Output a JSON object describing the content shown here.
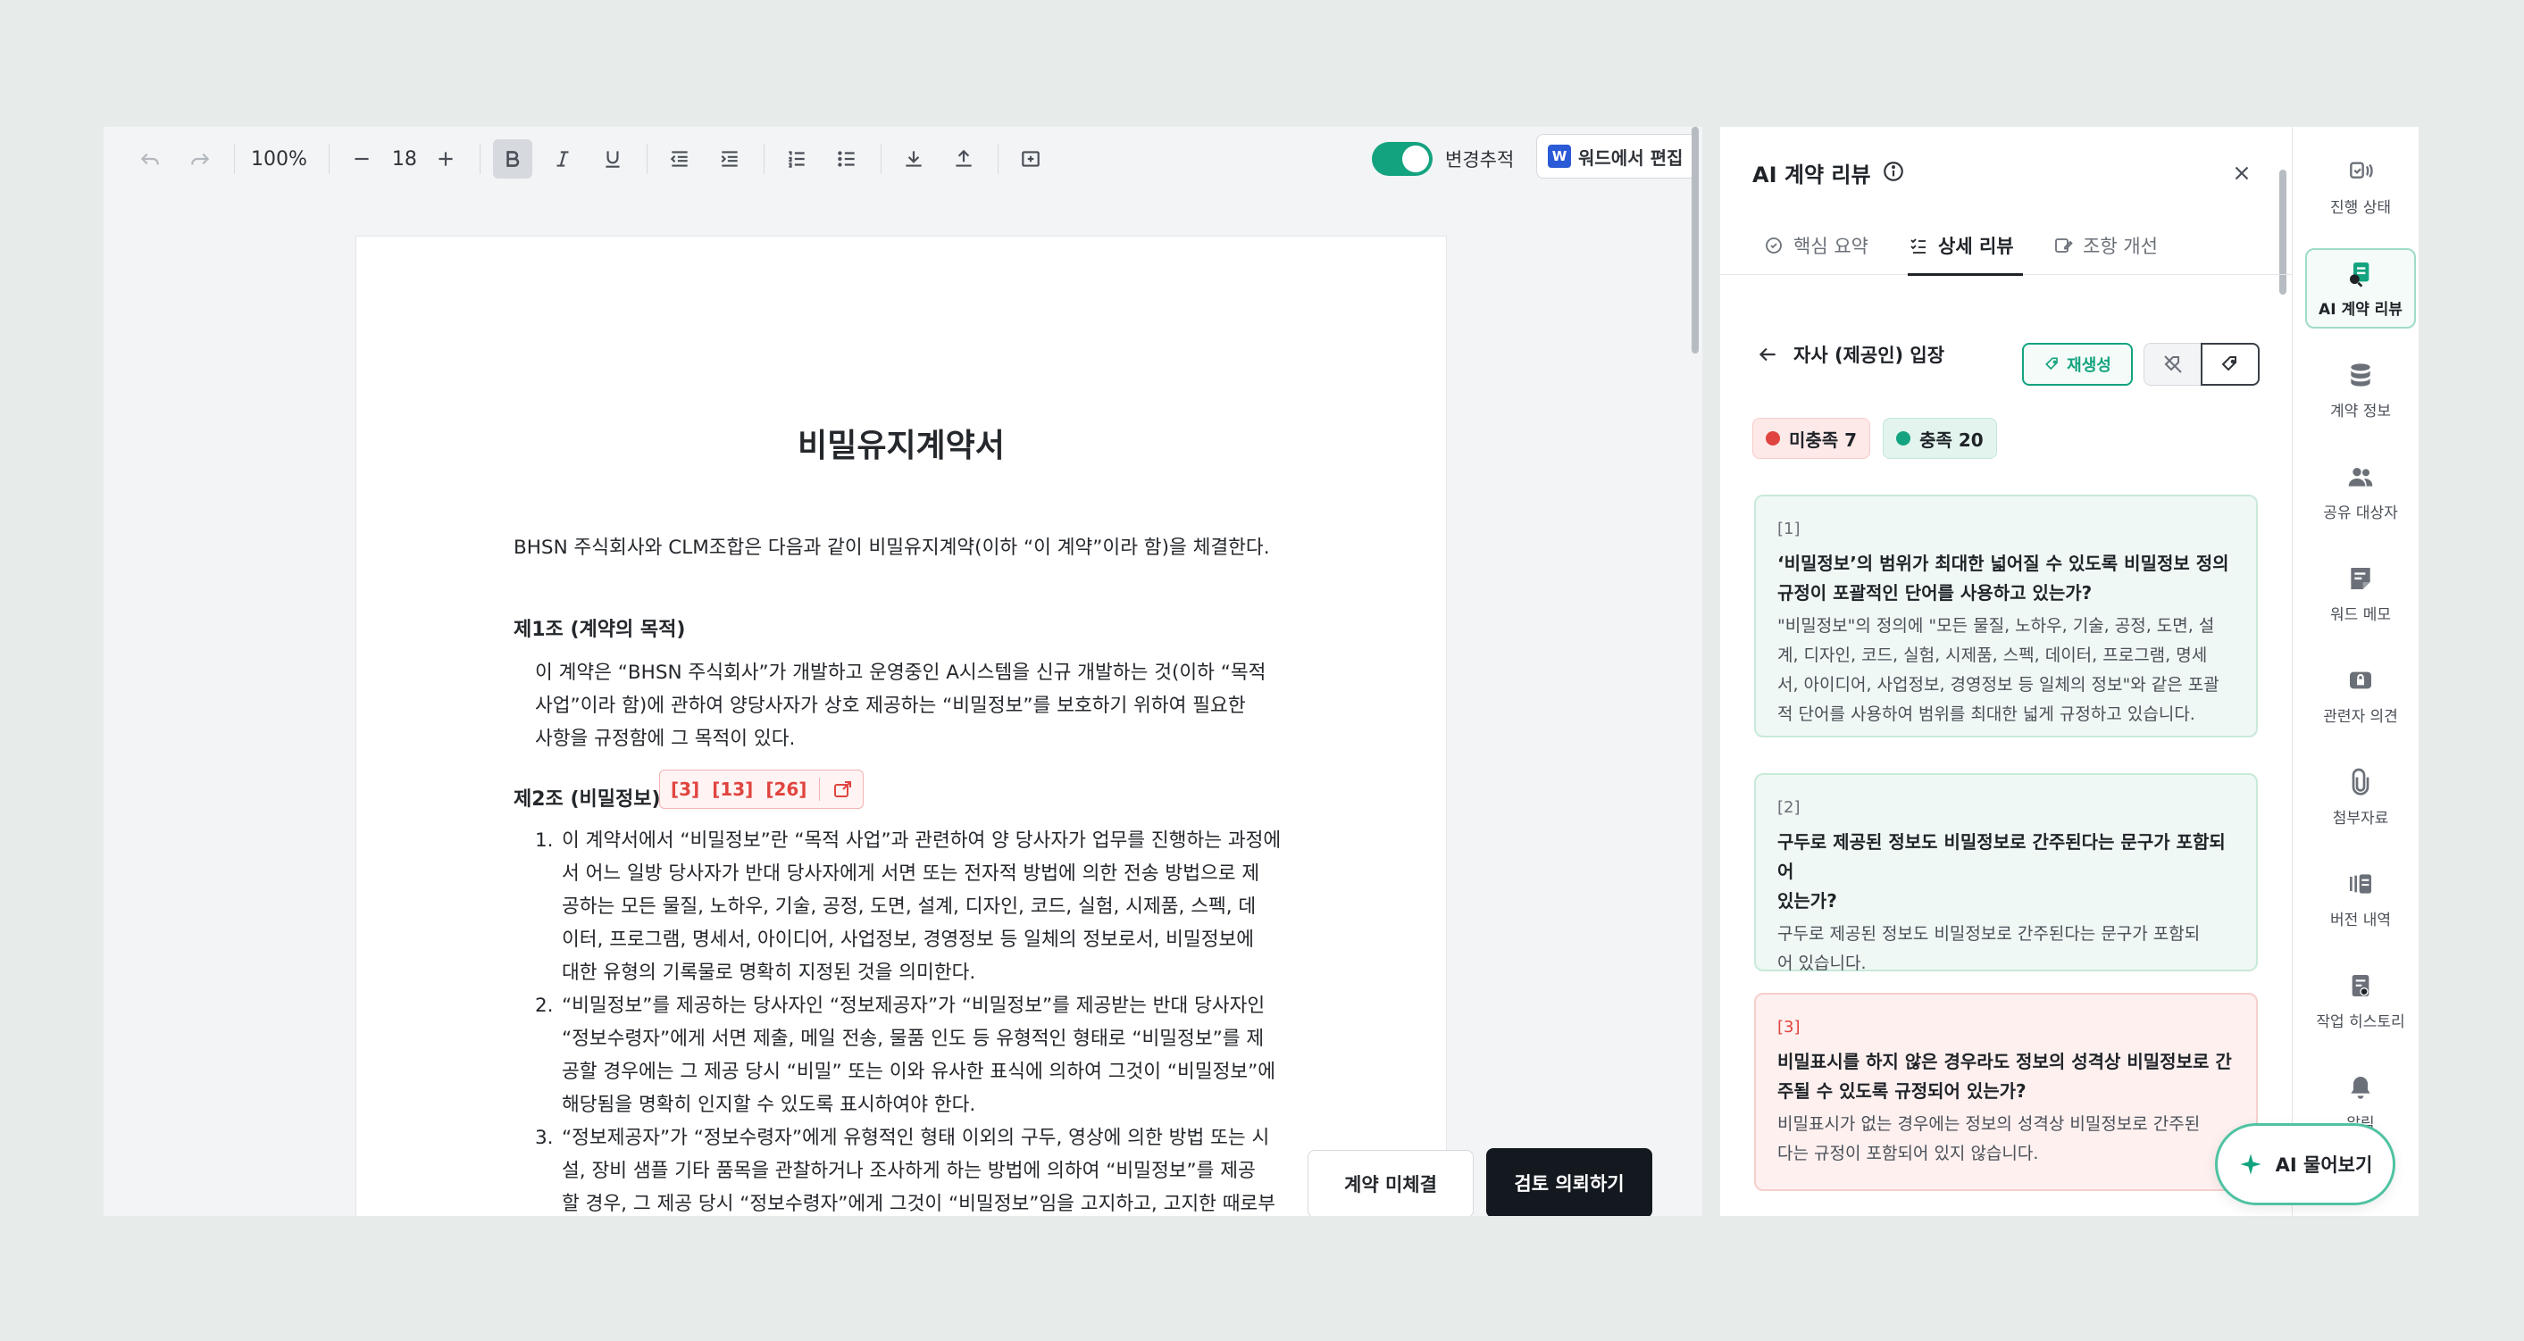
{
  "toolbar": {
    "zoom": "100%",
    "font_size": "18",
    "track_changes_label": "변경추적",
    "word_edit_label": "워드에서 편집",
    "word_icon_letter": "W"
  },
  "document": {
    "title": "비밀유지계약서",
    "intro": "BHSN 주식회사와 CLM조합은 다음과 같이 비밀유지계약(이하 “이 계약”이라 함)을 체결한다.",
    "article1": {
      "heading": "제1조 (계약의 목적)",
      "lines": [
        "이 계약은 “BHSN 주식회사”가 개발하고 운영중인 A시스템을 신규 개발하는 것(이하 “목적",
        "사업”이라 함)에 관하여 양당사자가 상호 제공하는 “비밀정보”를 보호하기 위하여 필요한",
        "사항을 규정함에 그 목적이 있다."
      ]
    },
    "article2": {
      "heading": "제2조 (비밀정보)",
      "ref_tags": [
        "[3]",
        "[13]",
        "[26]"
      ],
      "items": [
        {
          "num": "1.",
          "lines": [
            "이 계약서에서 “비밀정보”란 “목적 사업”과 관련하여 양 당사자가 업무를 진행하는 과정에",
            "서 어느 일방 당사자가 반대 당사자에게 서면 또는 전자적 방법에 의한 전송 방법으로 제",
            "공하는 모든 물질, 노하우, 기술, 공정, 도면, 설계, 디자인, 코드, 실험, 시제품, 스펙, 데",
            "이터, 프로그램, 명세서, 아이디어, 사업정보, 경영정보 등 일체의 정보로서, 비밀정보에",
            "대한 유형의 기록물로 명확히 지정된 것을 의미한다."
          ]
        },
        {
          "num": "2.",
          "lines": [
            "“비밀정보”를 제공하는 당사자인 “정보제공자”가 “비밀정보”를 제공받는 반대 당사자인",
            "“정보수령자”에게 서면 제출, 메일 전송, 물품 인도 등 유형적인 형태로 “비밀정보”를 제",
            "공할 경우에는 그 제공 당시 “비밀” 또는 이와 유사한 표식에 의하여 그것이 “비밀정보”에",
            "해당됨을 명확히 인지할 수 있도록 표시하여야 한다."
          ]
        },
        {
          "num": "3.",
          "lines": [
            "“정보제공자”가 “정보수령자”에게 유형적인 형태 이외의 구두, 영상에 의한 방법 또는 시",
            "설, 장비 샘플 기타 품목을 관찰하거나 조사하게 하는 방법에 의하여 “비밀정보”를 제공",
            "할 경우, 그 제공 당시 “정보수령자”에게 그것이 “비밀정보”임을 고지하고, 고지한 때로부"
          ]
        }
      ]
    }
  },
  "actions": {
    "unsigned_label": "계약 미체결",
    "review_request_label": "검토 의뢰하기"
  },
  "ai_panel": {
    "title": "AI 계약 리뷰",
    "tabs": [
      {
        "label": "핵심 요약"
      },
      {
        "label": "상세 리뷰"
      },
      {
        "label": "조항 개선"
      }
    ],
    "position_label": "자사 (제공인) 입장",
    "regenerate_label": "재생성",
    "status": {
      "unmet_label": "미충족 7",
      "met_label": "충족 20"
    },
    "cards": [
      {
        "num": "[1]",
        "status": "met",
        "question": [
          "‘비밀정보’의 범위가 최대한 넓어질 수 있도록 비밀정보 정의",
          "규정이 포괄적인 단어를 사용하고 있는가?"
        ],
        "answer": [
          "\"비밀정보\"의 정의에 \"모든 물질, 노하우, 기술, 공정, 도면, 설",
          "계, 디자인, 코드, 실험, 시제품, 스펙, 데이터, 프로그램, 명세",
          "서, 아이디어, 사업정보, 경영정보 등 일체의 정보\"와 같은 포괄",
          "적 단어를 사용하여 범위를 최대한 넓게 규정하고 있습니다."
        ]
      },
      {
        "num": "[2]",
        "status": "met",
        "question": [
          "구두로 제공된 정보도 비밀정보로 간주된다는 문구가 포함되어",
          "있는가?"
        ],
        "answer": [
          "구두로 제공된 정보도 비밀정보로 간주된다는 문구가 포함되",
          "어 있습니다."
        ]
      },
      {
        "num": "[3]",
        "status": "unmet",
        "question": [
          "비밀표시를 하지 않은 경우라도 정보의 성격상 비밀정보로 간",
          "주될 수 있도록 규정되어 있는가?"
        ],
        "answer": [
          "비밀표시가 없는 경우에는 정보의 성격상 비밀정보로 간주된",
          "다는 규정이 포함되어 있지 않습니다."
        ]
      }
    ]
  },
  "right_nav": {
    "items": [
      {
        "label": "진행 상태",
        "icon": "progress-icon"
      },
      {
        "label": "AI 계약 리뷰",
        "icon": "ai-review-icon"
      },
      {
        "label": "계약 정보",
        "icon": "database-icon"
      },
      {
        "label": "공유 대상자",
        "icon": "people-icon"
      },
      {
        "label": "워드 메모",
        "icon": "memo-icon"
      },
      {
        "label": "관련자 의견",
        "icon": "opinion-lock-icon"
      },
      {
        "label": "첨부자료",
        "icon": "paperclip-icon"
      },
      {
        "label": "버전 내역",
        "icon": "version-icon"
      },
      {
        "label": "작업 히스토리",
        "icon": "history-icon"
      },
      {
        "label": "알림",
        "icon": "bell-icon"
      }
    ]
  },
  "ask_ai_label": "AI 물어보기",
  "colors": {
    "accent": "#14a37f",
    "unmet": "#e0443f",
    "dark_button": "#141920"
  }
}
